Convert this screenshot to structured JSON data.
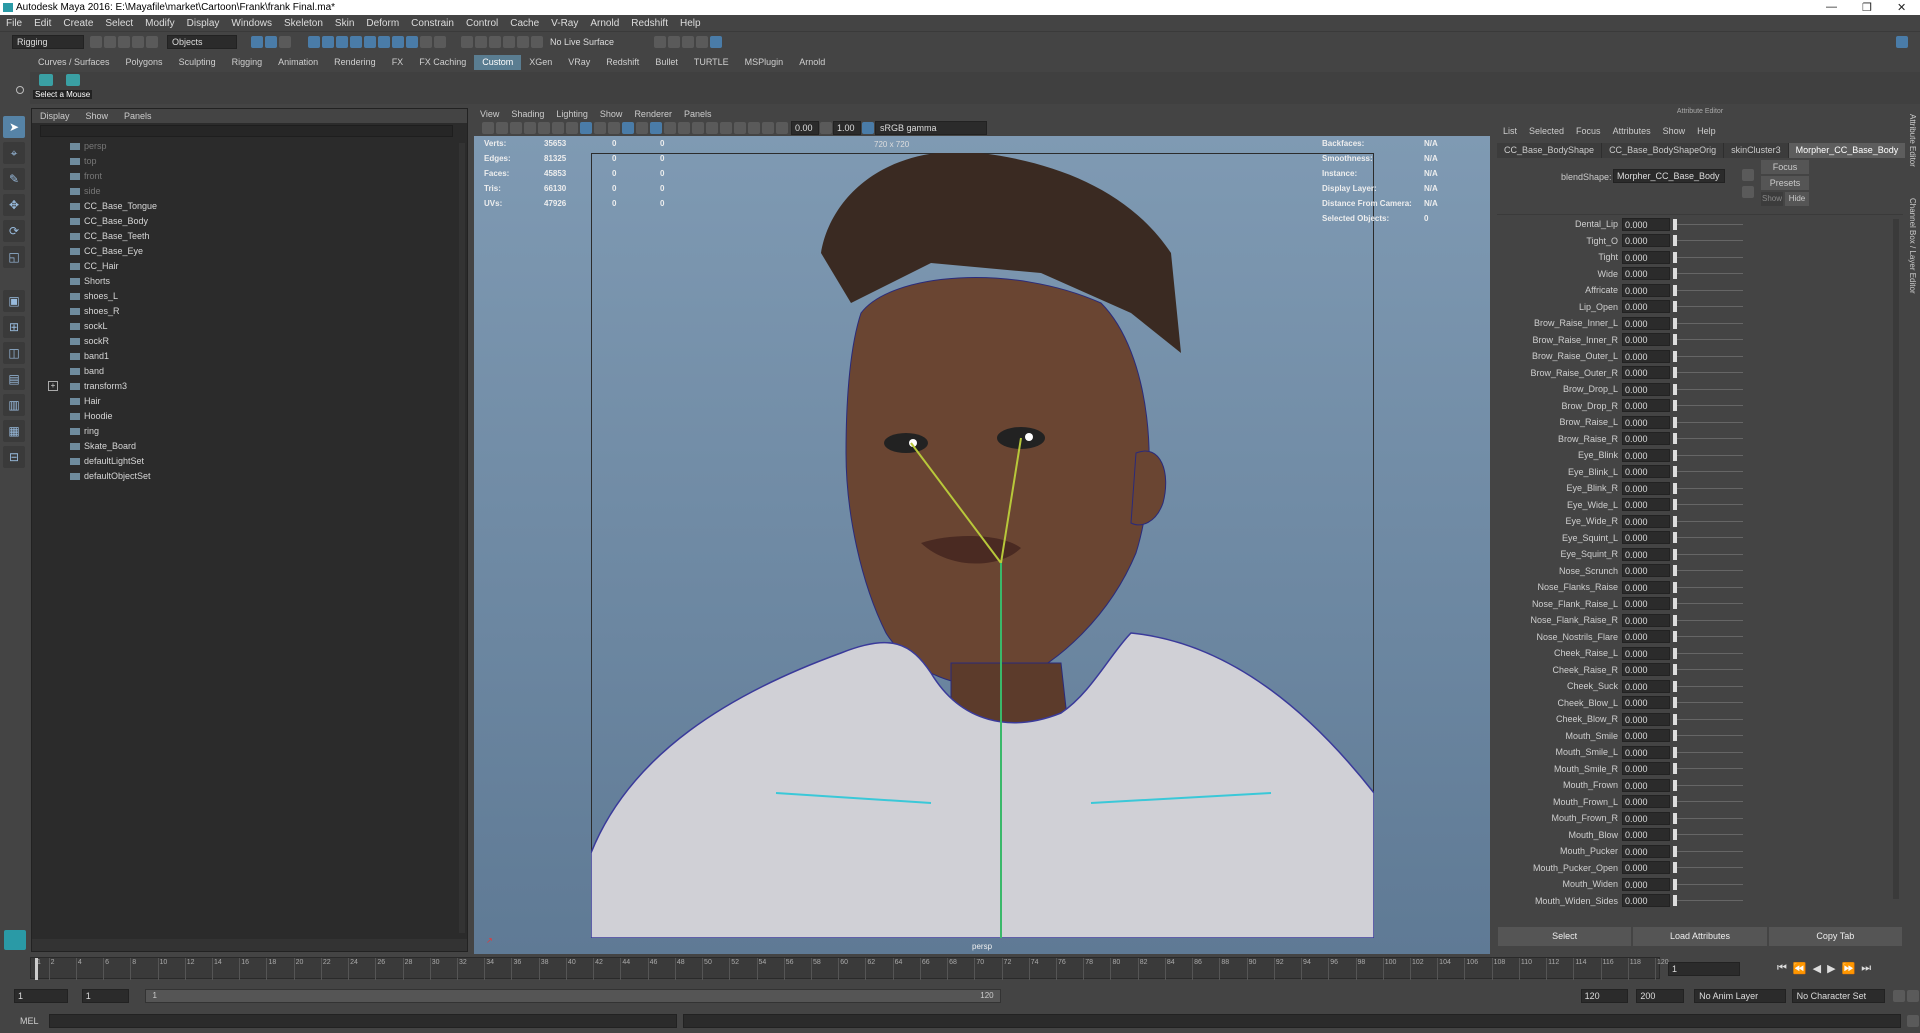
{
  "window": {
    "title": "Autodesk Maya 2016: E:\\Mayafile\\market\\Cartoon\\Frank\\frank Final.ma*"
  },
  "menu": [
    "File",
    "Edit",
    "Create",
    "Select",
    "Modify",
    "Display",
    "Windows",
    "Skeleton",
    "Skin",
    "Deform",
    "Constrain",
    "Control",
    "Cache",
    "V-Ray",
    "Arnold",
    "Redshift",
    "Help"
  ],
  "status": {
    "mode": "Rigging",
    "objects": "Objects",
    "live_surface": "No Live Surface"
  },
  "shelf": {
    "tabs": [
      "Curves / Surfaces",
      "Polygons",
      "Sculpting",
      "Rigging",
      "Animation",
      "Rendering",
      "FX",
      "FX Caching",
      "Custom",
      "XGen",
      "VRay",
      "Redshift",
      "Bullet",
      "TURTLE",
      "MSPlugin",
      "Arnold"
    ],
    "active": "Custom",
    "tooltip": "Select a Mouse"
  },
  "outliner": {
    "menu": [
      "Display",
      "Show",
      "Panels"
    ],
    "items": [
      {
        "label": "persp",
        "dim": true
      },
      {
        "label": "top",
        "dim": true
      },
      {
        "label": "front",
        "dim": true
      },
      {
        "label": "side",
        "dim": true
      },
      {
        "label": "CC_Base_Tongue"
      },
      {
        "label": "CC_Base_Body"
      },
      {
        "label": "CC_Base_Teeth"
      },
      {
        "label": "CC_Base_Eye"
      },
      {
        "label": "CC_Hair"
      },
      {
        "label": "Shorts"
      },
      {
        "label": "shoes_L"
      },
      {
        "label": "shoes_R"
      },
      {
        "label": "sockL"
      },
      {
        "label": "sockR"
      },
      {
        "label": "band1"
      },
      {
        "label": "band"
      },
      {
        "label": "transform3",
        "expand": true
      },
      {
        "label": "Hair"
      },
      {
        "label": "Hoodie"
      },
      {
        "label": "ring"
      },
      {
        "label": "Skate_Board"
      },
      {
        "label": "defaultLightSet"
      },
      {
        "label": "defaultObjectSet"
      }
    ]
  },
  "viewport": {
    "menu": [
      "View",
      "Shading",
      "Lighting",
      "Show",
      "Renderer",
      "Panels"
    ],
    "exposure": "0.00",
    "gamma": "1.00",
    "colorspace": "sRGB gamma",
    "resolution": "720 x 720",
    "camera": "persp",
    "hud_left": [
      {
        "k": "Verts:",
        "v": "35653",
        "a": "0",
        "b": "0"
      },
      {
        "k": "Edges:",
        "v": "81325",
        "a": "0",
        "b": "0"
      },
      {
        "k": "Faces:",
        "v": "45853",
        "a": "0",
        "b": "0"
      },
      {
        "k": "Tris:",
        "v": "66130",
        "a": "0",
        "b": "0"
      },
      {
        "k": "UVs:",
        "v": "47926",
        "a": "0",
        "b": "0"
      }
    ],
    "hud_right": [
      {
        "k": "Backfaces:",
        "v": "N/A"
      },
      {
        "k": "Smoothness:",
        "v": "N/A"
      },
      {
        "k": "Instance:",
        "v": "N/A"
      },
      {
        "k": "Display Layer:",
        "v": "N/A"
      },
      {
        "k": "Distance From Camera:",
        "v": "N/A"
      },
      {
        "k": "Selected Objects:",
        "v": "0"
      }
    ]
  },
  "attr": {
    "title": "Attribute Editor",
    "menu": [
      "List",
      "Selected",
      "Focus",
      "Attributes",
      "Show",
      "Help"
    ],
    "tabs": [
      "CC_Base_BodyShape",
      "CC_Base_BodyShapeOrig",
      "skinCluster3",
      "Morpher_CC_Base_Body"
    ],
    "active_tab": "Morpher_CC_Base_Body",
    "blendshape_label": "blendShape:",
    "blendshape_value": "Morpher_CC_Base_Body",
    "focus": "Focus",
    "presets": "Presets",
    "show": "Show",
    "hide": "Hide",
    "rows": [
      {
        "n": "Dental_Lip",
        "v": "0.000"
      },
      {
        "n": "Tight_O",
        "v": "0.000"
      },
      {
        "n": "Tight",
        "v": "0.000"
      },
      {
        "n": "Wide",
        "v": "0.000"
      },
      {
        "n": "Affricate",
        "v": "0.000"
      },
      {
        "n": "Lip_Open",
        "v": "0.000"
      },
      {
        "n": "Brow_Raise_Inner_L",
        "v": "0.000"
      },
      {
        "n": "Brow_Raise_Inner_R",
        "v": "0.000"
      },
      {
        "n": "Brow_Raise_Outer_L",
        "v": "0.000"
      },
      {
        "n": "Brow_Raise_Outer_R",
        "v": "0.000"
      },
      {
        "n": "Brow_Drop_L",
        "v": "0.000"
      },
      {
        "n": "Brow_Drop_R",
        "v": "0.000"
      },
      {
        "n": "Brow_Raise_L",
        "v": "0.000"
      },
      {
        "n": "Brow_Raise_R",
        "v": "0.000"
      },
      {
        "n": "Eye_Blink",
        "v": "0.000"
      },
      {
        "n": "Eye_Blink_L",
        "v": "0.000"
      },
      {
        "n": "Eye_Blink_R",
        "v": "0.000"
      },
      {
        "n": "Eye_Wide_L",
        "v": "0.000"
      },
      {
        "n": "Eye_Wide_R",
        "v": "0.000"
      },
      {
        "n": "Eye_Squint_L",
        "v": "0.000"
      },
      {
        "n": "Eye_Squint_R",
        "v": "0.000"
      },
      {
        "n": "Nose_Scrunch",
        "v": "0.000"
      },
      {
        "n": "Nose_Flanks_Raise",
        "v": "0.000"
      },
      {
        "n": "Nose_Flank_Raise_L",
        "v": "0.000"
      },
      {
        "n": "Nose_Flank_Raise_R",
        "v": "0.000"
      },
      {
        "n": "Nose_Nostrils_Flare",
        "v": "0.000"
      },
      {
        "n": "Cheek_Raise_L",
        "v": "0.000"
      },
      {
        "n": "Cheek_Raise_R",
        "v": "0.000"
      },
      {
        "n": "Cheek_Suck",
        "v": "0.000"
      },
      {
        "n": "Cheek_Blow_L",
        "v": "0.000"
      },
      {
        "n": "Cheek_Blow_R",
        "v": "0.000"
      },
      {
        "n": "Mouth_Smile",
        "v": "0.000"
      },
      {
        "n": "Mouth_Smile_L",
        "v": "0.000"
      },
      {
        "n": "Mouth_Smile_R",
        "v": "0.000"
      },
      {
        "n": "Mouth_Frown",
        "v": "0.000"
      },
      {
        "n": "Mouth_Frown_L",
        "v": "0.000"
      },
      {
        "n": "Mouth_Frown_R",
        "v": "0.000"
      },
      {
        "n": "Mouth_Blow",
        "v": "0.000"
      },
      {
        "n": "Mouth_Pucker",
        "v": "0.000"
      },
      {
        "n": "Mouth_Pucker_Open",
        "v": "0.000"
      },
      {
        "n": "Mouth_Widen",
        "v": "0.000"
      },
      {
        "n": "Mouth_Widen_Sides",
        "v": "0.000"
      }
    ],
    "buttons": [
      "Select",
      "Load Attributes",
      "Copy Tab"
    ]
  },
  "side_tabs": [
    "Attribute Editor",
    "Channel Box / Layer Editor"
  ],
  "timeline": {
    "labels": [
      "1",
      "2",
      "4",
      "6",
      "8",
      "10",
      "12",
      "14",
      "16",
      "18",
      "20",
      "22",
      "24",
      "26",
      "28",
      "30",
      "32",
      "34",
      "36",
      "38",
      "40",
      "42",
      "44",
      "46",
      "48",
      "50",
      "52",
      "54",
      "56",
      "58",
      "60",
      "62",
      "64",
      "66",
      "68",
      "70",
      "72",
      "74",
      "76",
      "78",
      "80",
      "82",
      "84",
      "86",
      "88",
      "90",
      "92",
      "94",
      "96",
      "98",
      "100",
      "102",
      "104",
      "106",
      "108",
      "110",
      "112",
      "114",
      "116",
      "118",
      "120"
    ],
    "current": "1"
  },
  "range": {
    "start": "1",
    "start2": "1",
    "slider_start": "1",
    "slider_end": "120",
    "end": "120",
    "end2": "200",
    "anim_layer": "No Anim Layer",
    "char_set": "No Character Set"
  },
  "cmd": {
    "lang": "MEL"
  }
}
